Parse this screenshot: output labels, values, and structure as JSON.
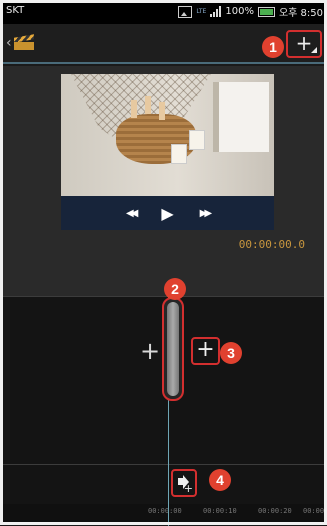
{
  "status_bar": {
    "carrier": "SKT",
    "network": "LTE",
    "battery": "100%",
    "time": "오후 8:50"
  },
  "toolbar": {
    "add_media_label": "+"
  },
  "preview": {
    "timecode": "00:00:00.0",
    "rewind_icon": "◀◀",
    "play_icon": "▶",
    "fast_forward_icon": "▶▶"
  },
  "timeline": {
    "add_left_label": "+",
    "add_right_label": "+",
    "audio_plus": "+",
    "ruler_labels": [
      "00:00:00",
      "00:00:10",
      "00:00:20",
      "00:00"
    ]
  },
  "callouts": [
    "1",
    "2",
    "3",
    "4"
  ],
  "colors": {
    "highlight": "#d32f2f",
    "callout": "#e0412f",
    "timecode": "#c8963e",
    "playhead": "#6fa6b5"
  }
}
